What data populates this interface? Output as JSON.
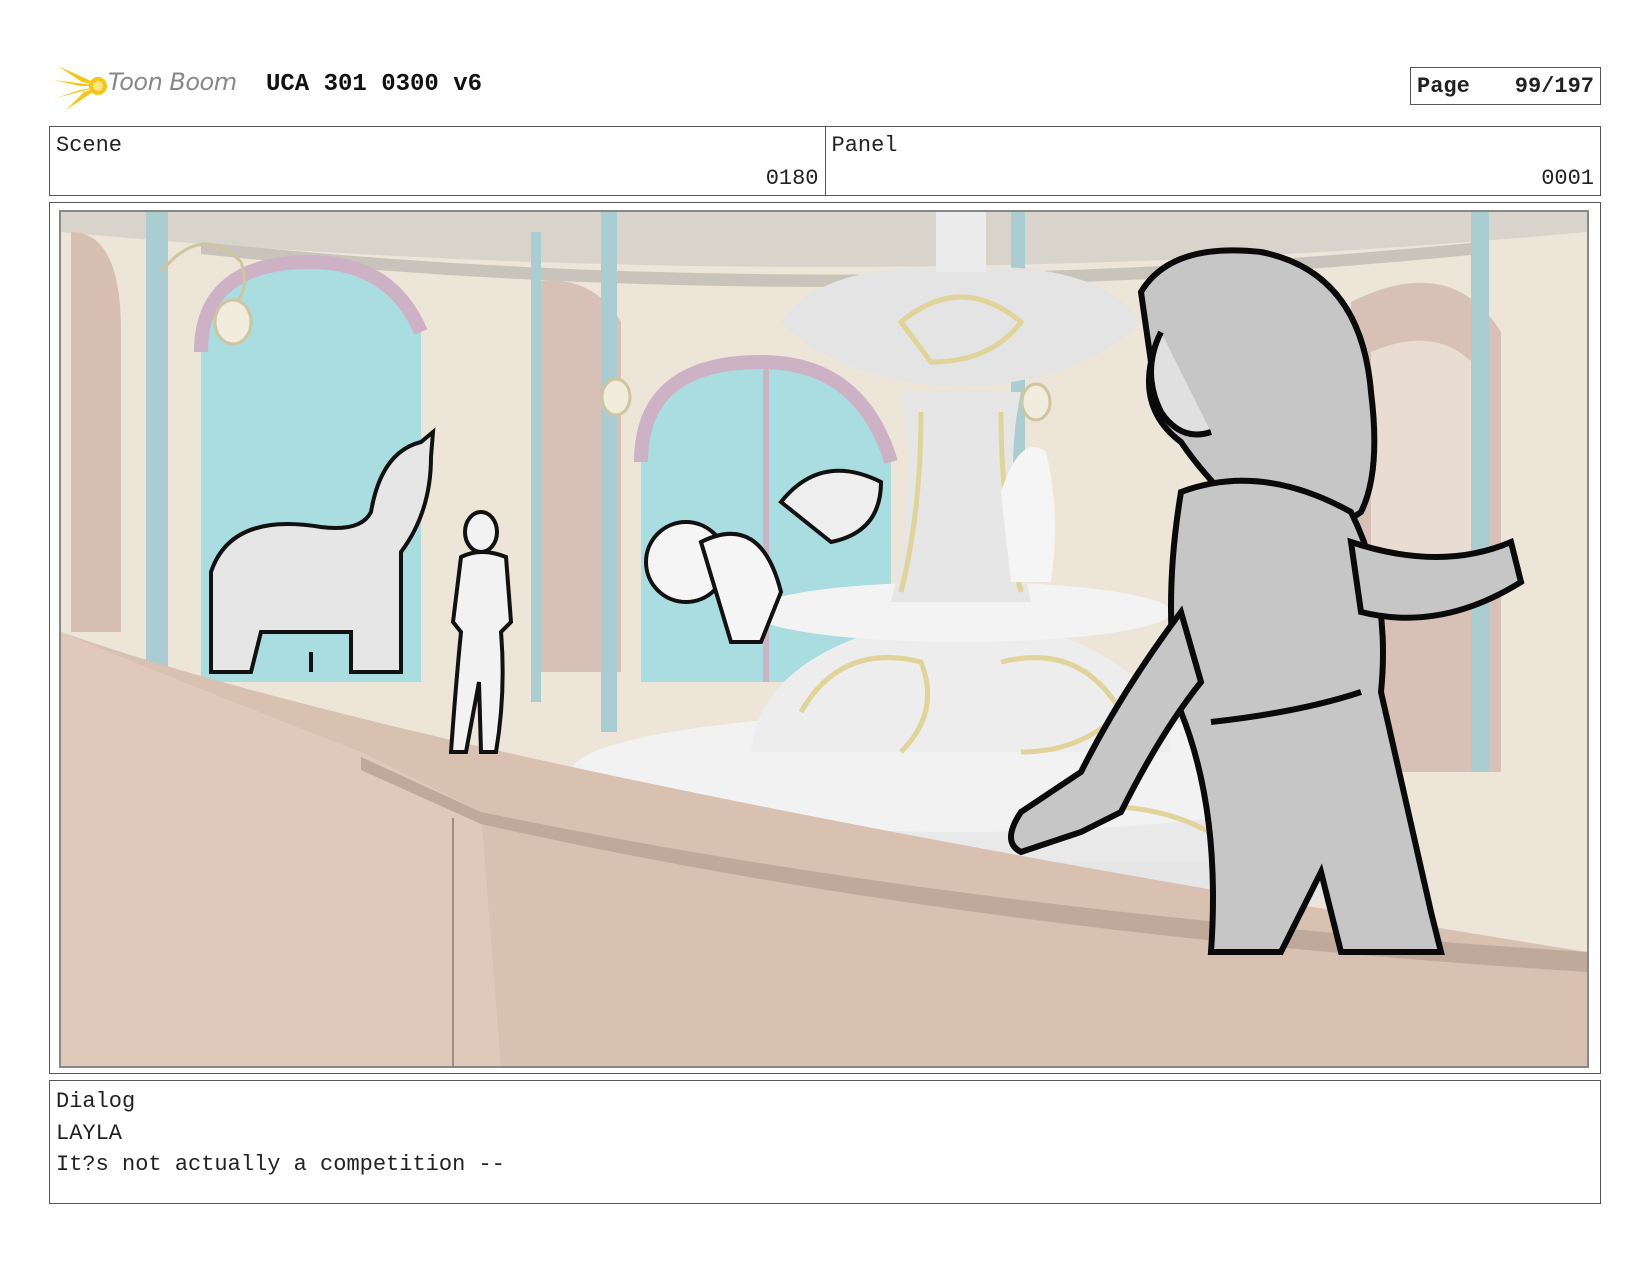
{
  "header": {
    "logo_text": "Toon Boom",
    "title": "UCA 301 0300 v6",
    "page_label": "Page",
    "page_number": "99/197"
  },
  "scene": {
    "label": "Scene",
    "value": "0180"
  },
  "panel": {
    "label": "Panel",
    "value": "0001"
  },
  "dialog": {
    "label": "Dialog",
    "speaker": "LAYLA",
    "line": "It?s not actually a competition --"
  },
  "colors": {
    "logo_yellow": "#f5c518",
    "floor": "#d9c0b0",
    "wall": "#ebe4d8",
    "window_sky": "#a9dde0",
    "pillar": "#a9cdd0",
    "fountain": "#e8e8e8",
    "gold_trim": "#e0d49a",
    "character_fill": "#c6c6c6"
  }
}
